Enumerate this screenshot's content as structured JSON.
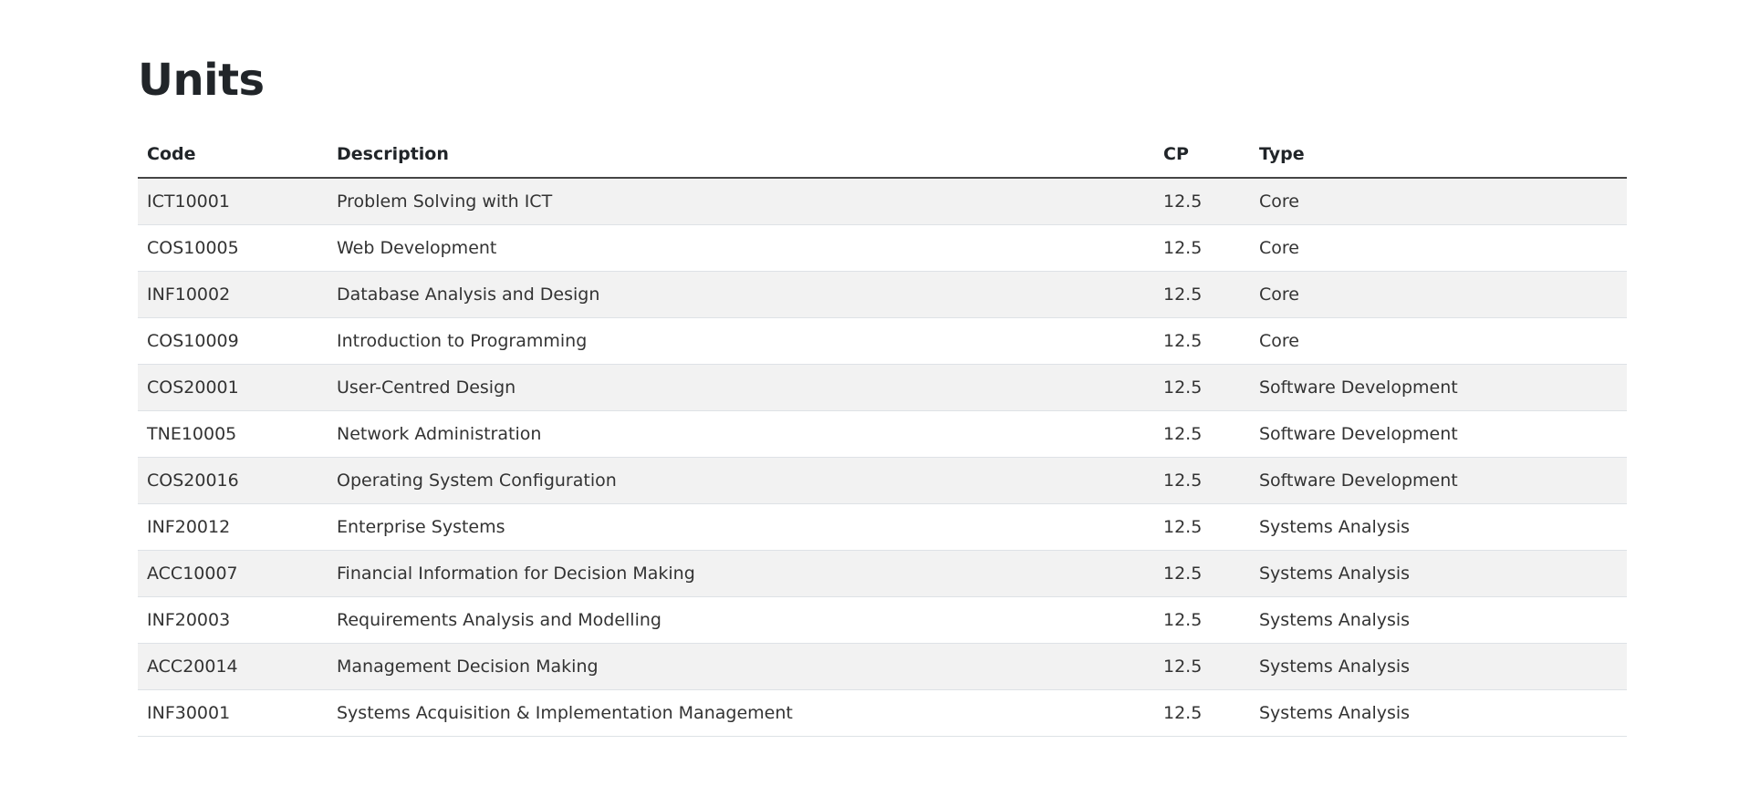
{
  "page": {
    "title": "Units"
  },
  "table": {
    "headers": {
      "code": "Code",
      "description": "Description",
      "cp": "CP",
      "type": "Type"
    },
    "rows": [
      {
        "code": "ICT10001",
        "description": "Problem Solving with ICT",
        "cp": "12.5",
        "type": "Core"
      },
      {
        "code": "COS10005",
        "description": "Web Development",
        "cp": "12.5",
        "type": "Core"
      },
      {
        "code": "INF10002",
        "description": "Database Analysis and Design",
        "cp": "12.5",
        "type": "Core"
      },
      {
        "code": "COS10009",
        "description": "Introduction to Programming",
        "cp": "12.5",
        "type": "Core"
      },
      {
        "code": "COS20001",
        "description": "User-Centred Design",
        "cp": "12.5",
        "type": "Software Development"
      },
      {
        "code": "TNE10005",
        "description": "Network Administration",
        "cp": "12.5",
        "type": "Software Development"
      },
      {
        "code": "COS20016",
        "description": "Operating System Configuration",
        "cp": "12.5",
        "type": "Software Development"
      },
      {
        "code": "INF20012",
        "description": "Enterprise Systems",
        "cp": "12.5",
        "type": "Systems Analysis"
      },
      {
        "code": "ACC10007",
        "description": "Financial Information for Decision Making",
        "cp": "12.5",
        "type": "Systems Analysis"
      },
      {
        "code": "INF20003",
        "description": "Requirements Analysis and Modelling",
        "cp": "12.5",
        "type": "Systems Analysis"
      },
      {
        "code": "ACC20014",
        "description": "Management Decision Making",
        "cp": "12.5",
        "type": "Systems Analysis"
      },
      {
        "code": "INF30001",
        "description": "Systems Acquisition & Implementation Management",
        "cp": "12.5",
        "type": "Systems Analysis"
      }
    ]
  },
  "colors": {
    "text": "#212529",
    "stripe": "#f2f2f2",
    "header_border": "#454545",
    "row_border": "#dee2e6"
  }
}
